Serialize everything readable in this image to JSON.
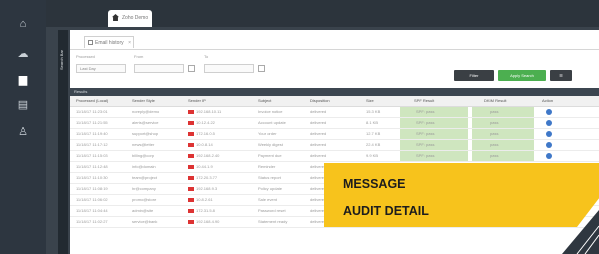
{
  "browser": {
    "tab_title": "Zoho Demo"
  },
  "sidebar": {
    "vertical_label": "Search Bar",
    "icons": [
      "home-icon",
      "cloud-icon",
      "dashboard-icon",
      "report-icon",
      "user-icon"
    ]
  },
  "panel": {
    "tab_label": "Email history",
    "tab_close": "×",
    "filters": [
      {
        "label": "Processed",
        "value": "Last Day"
      },
      {
        "label": "From",
        "value": ""
      },
      {
        "label": "To",
        "value": ""
      }
    ],
    "buttons": {
      "filter": "Filter",
      "apply": "Apply Search",
      "more": "☰"
    },
    "hint": "Results",
    "grid_title": "Results",
    "columns": [
      "Processed (Local)",
      "Sender Style",
      "Sender IP",
      "Subject",
      "Disposition",
      "Size",
      "SPF Result",
      "DKIM Result",
      "Action"
    ],
    "rows": [
      [
        "11/18/17 11:23:01",
        "noreply@demo",
        "192.168.10.11",
        "Invoice notice",
        "delivered",
        "15.3 KB",
        "SPF: pass",
        "pass"
      ],
      [
        "11/18/17 11:21:55",
        "alerts@service",
        "10.12.4.22",
        "Account update",
        "delivered",
        "8.1 KB",
        "SPF: pass",
        "pass"
      ],
      [
        "11/18/17 11:19:40",
        "support@shop",
        "172.16.0.5",
        "Your order",
        "delivered",
        "12.7 KB",
        "SPF: pass",
        "pass"
      ],
      [
        "11/18/17 11:17:12",
        "news@letter",
        "10.0.8.14",
        "Weekly digest",
        "delivered",
        "22.4 KB",
        "SPF: pass",
        "pass"
      ],
      [
        "11/18/17 11:15:03",
        "billing@corp",
        "192.168.2.40",
        "Payment due",
        "delivered",
        "9.9 KB",
        "SPF: pass",
        "pass"
      ],
      [
        "11/18/17 11:12:48",
        "info@domain",
        "10.44.1.9",
        "Reminder",
        "delivered",
        "6.2 KB",
        "",
        ""
      ],
      [
        "11/18/17 11:10:30",
        "team@project",
        "172.20.3.77",
        "Status report",
        "delivered",
        "31.0 KB",
        "",
        ""
      ],
      [
        "11/18/17 11:08:19",
        "hr@company",
        "192.168.9.3",
        "Policy update",
        "delivered",
        "14.5 KB",
        "",
        ""
      ],
      [
        "11/18/17 11:06:02",
        "promo@store",
        "10.8.2.61",
        "Sale event",
        "delivered",
        "18.8 KB",
        "",
        ""
      ],
      [
        "11/18/17 11:04:44",
        "admin@site",
        "172.31.5.8",
        "Password reset",
        "delivered",
        "5.4 KB",
        "SPF: pass",
        "pass"
      ],
      [
        "11/18/17 11:02:27",
        "service@bank",
        "192.168.4.90",
        "Statement ready",
        "delivered",
        "11.2 KB",
        "SPF: pass",
        "pass"
      ]
    ]
  },
  "callout": {
    "line1": "MESSAGE",
    "line2": "AUDIT DETAIL"
  },
  "colors": {
    "rail": "#2d3640",
    "callout": "#f7c31c",
    "filter_button": "#3a3f44",
    "apply_button": "#4caf50",
    "success_cell": "#cfe6bf",
    "action_icon": "#3f78c8",
    "country_flag": "#d33333"
  }
}
